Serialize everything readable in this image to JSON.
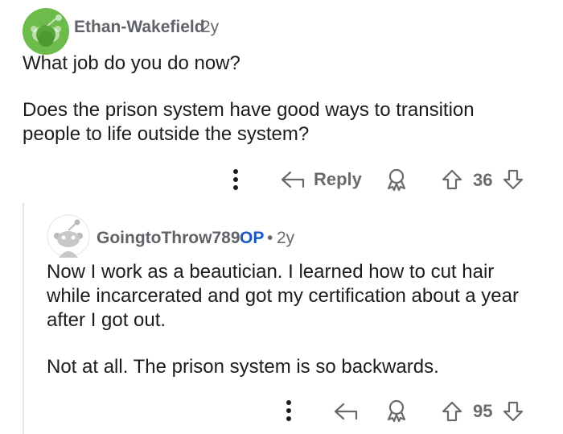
{
  "parent_comment": {
    "username": "Ethan-Wakefield",
    "age": "2y",
    "paragraphs": [
      "What job do you do now?",
      "Does the prison system have good ways to transition people to life outside the system?"
    ],
    "actions": {
      "more_icon": "more-vertical-icon",
      "reply_label": "Reply",
      "award_icon": "award-icon",
      "upvote_icon": "upvote-arrow-icon",
      "vote_count": "36",
      "downvote_icon": "downvote-arrow-icon"
    },
    "avatar_color": "#6dbb4a"
  },
  "reply_comment": {
    "username": "GoingtoThrow789",
    "op_badge": "OP",
    "separator": "•",
    "age": "2y",
    "paragraphs": [
      "Now I work as a beautician. I learned how to cut hair while incarcerated and got my certification about a year after I got out.",
      "Not at all. The prison system is so backwards."
    ],
    "actions": {
      "more_icon": "more-vertical-icon",
      "reply_icon": "reply-arrow-icon",
      "award_icon": "award-icon",
      "upvote_icon": "upvote-arrow-icon",
      "vote_count": "95",
      "downvote_icon": "downvote-arrow-icon"
    },
    "avatar_color": "#c8c8c8"
  },
  "colors": {
    "text": "#1c1c1c",
    "meta": "#6a6a6a",
    "op_blue": "#1a58c4",
    "thread_line": "#e2e2e2"
  }
}
